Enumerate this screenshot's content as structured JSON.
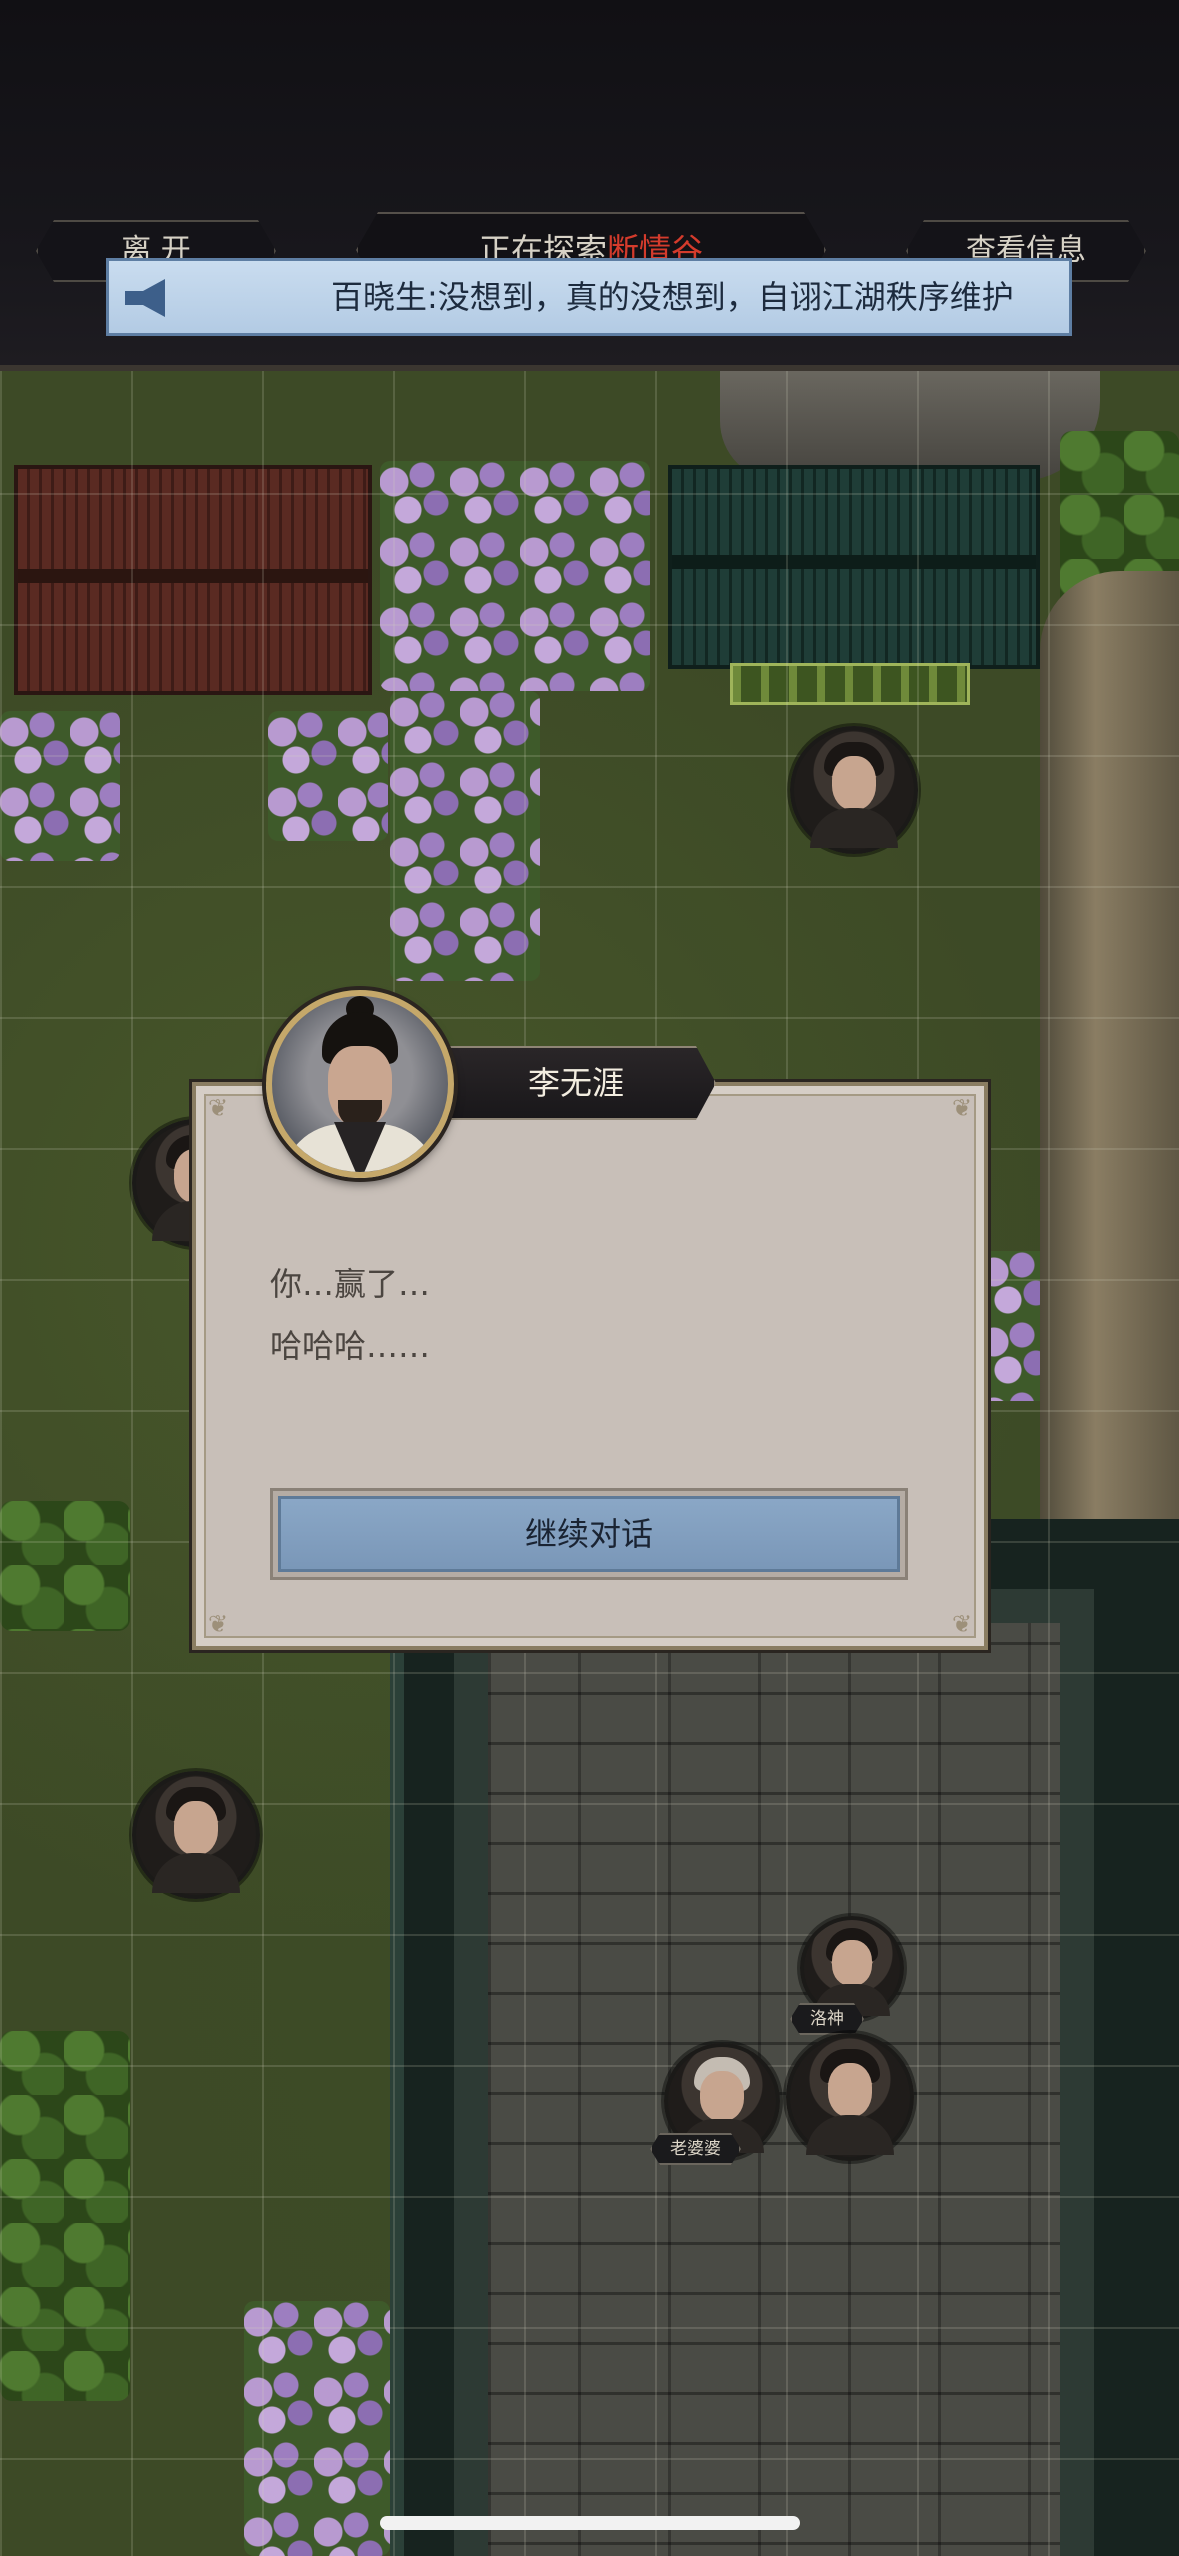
{
  "topbar": {
    "leave_label": "离 开",
    "exploring_prefix": "正在探索",
    "exploring_location": "断情谷",
    "view_info_label": "查看信息"
  },
  "announcement": {
    "icon": "megaphone-icon",
    "text": "百晓生:没想到，真的没想到，自诩江湖秩序维护"
  },
  "dialog": {
    "speaker_name": "李无涯",
    "lines": [
      "你…赢了…",
      "哈哈哈……"
    ],
    "continue_label": "继续对话"
  },
  "map": {
    "tokens": [
      {
        "label": ""
      },
      {
        "label": ""
      },
      {
        "label": ""
      },
      {
        "label": "洛神"
      },
      {
        "label": "老婆婆"
      },
      {
        "label": ""
      }
    ]
  },
  "colors": {
    "location_highlight": "#d43b2c",
    "continue_button": "#8aa7c6",
    "announcement_bg": "#c9dcef",
    "dialog_bg": "#c8bfb8"
  }
}
